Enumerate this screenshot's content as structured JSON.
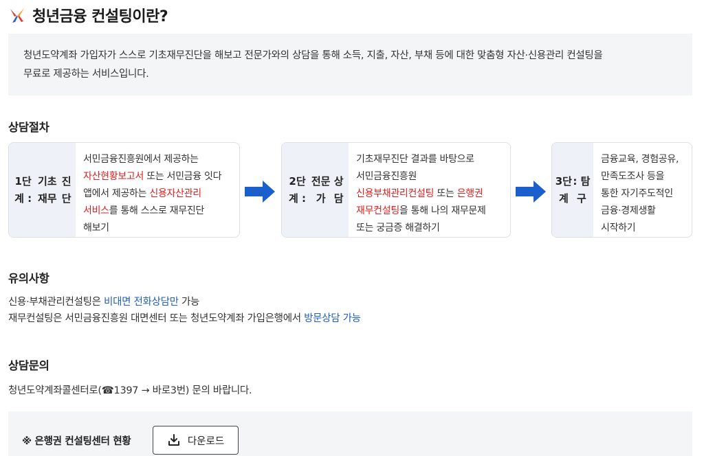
{
  "title": "청년금융 컨설팅이란?",
  "intro": {
    "line1": "청년도약계좌 가입자가 스스로 기초재무진단을 해보고 전문가와의 상담을 통해 소득, 지출, 자산, 부채 등에 대한 맞춤형 자산·신용관리 컨설팅을",
    "line2": "무료로 제공하는 서비스입니다."
  },
  "procedure": {
    "heading": "상담절차",
    "steps": [
      {
        "label_lines": [
          "1단계 :",
          "기초재무",
          "진단"
        ],
        "desc": [
          {
            "t": "서민금융진흥원에서 제공하는",
            "c": ""
          },
          {
            "t": "\n",
            "c": ""
          },
          {
            "t": "자산현황보고서",
            "c": "red"
          },
          {
            "t": " 또는 서민금융 잇다",
            "c": ""
          },
          {
            "t": "\n",
            "c": ""
          },
          {
            "t": "앱에서 제공하는 ",
            "c": ""
          },
          {
            "t": "신용자산관리",
            "c": "red"
          },
          {
            "t": "\n",
            "c": ""
          },
          {
            "t": "서비스",
            "c": "red"
          },
          {
            "t": "를 통해 스스로 재무진단",
            "c": ""
          },
          {
            "t": "\n",
            "c": ""
          },
          {
            "t": "해보기",
            "c": ""
          }
        ]
      },
      {
        "label_lines": [
          "2단계 :",
          "전문가",
          "상담"
        ],
        "desc": [
          {
            "t": "기초재무진단 결과를 바탕으로",
            "c": ""
          },
          {
            "t": "\n",
            "c": ""
          },
          {
            "t": "서민금융진흥원",
            "c": ""
          },
          {
            "t": "\n",
            "c": ""
          },
          {
            "t": "신용부채관리컨설팅",
            "c": "red"
          },
          {
            "t": " 또는 ",
            "c": ""
          },
          {
            "t": "은행권",
            "c": "red"
          },
          {
            "t": "\n",
            "c": ""
          },
          {
            "t": "재무컨설팅",
            "c": "red"
          },
          {
            "t": "을 통해 나의 재무문제",
            "c": ""
          },
          {
            "t": "\n",
            "c": ""
          },
          {
            "t": "또는 궁금증 해결하기",
            "c": ""
          }
        ]
      },
      {
        "label_lines": [
          "3단계",
          ": 탐구"
        ],
        "desc": [
          {
            "t": "금융교육, 경험공유,",
            "c": ""
          },
          {
            "t": "\n",
            "c": ""
          },
          {
            "t": "만족도조사 등을",
            "c": ""
          },
          {
            "t": "\n",
            "c": ""
          },
          {
            "t": "통한 자기주도적인",
            "c": ""
          },
          {
            "t": "\n",
            "c": ""
          },
          {
            "t": "금융·경제생활",
            "c": ""
          },
          {
            "t": "\n",
            "c": ""
          },
          {
            "t": "시작하기",
            "c": ""
          }
        ]
      }
    ]
  },
  "notes": {
    "heading": "유의사항",
    "line1_pre": "신용·부채관리컨설팅은 ",
    "line1_hl": "비대면 전화상담만",
    "line1_post": " 가능",
    "line2_pre": "재무컨설팅은 서민금융진흥원 대면센터 또는 청년도약계좌 가입은행에서 ",
    "line2_hl": "방문상담 가능"
  },
  "inquiry": {
    "heading": "상담문의",
    "text": "청년도약계좌콜센터로(☎1397 → 바로3번) 문의 바랍니다."
  },
  "download": {
    "label": "※ 은행권 컨설팅센터 현황",
    "button": "다운로드"
  },
  "colors": {
    "accent_red": "#e01e1e",
    "accent_blue": "#1f5fbf",
    "arrow_blue": "#1a5fcc",
    "panel_bg": "#f4f5f7"
  },
  "icons": {
    "logo": "brand-logo-icon",
    "arrow": "arrow-right-icon",
    "download": "download-icon"
  }
}
